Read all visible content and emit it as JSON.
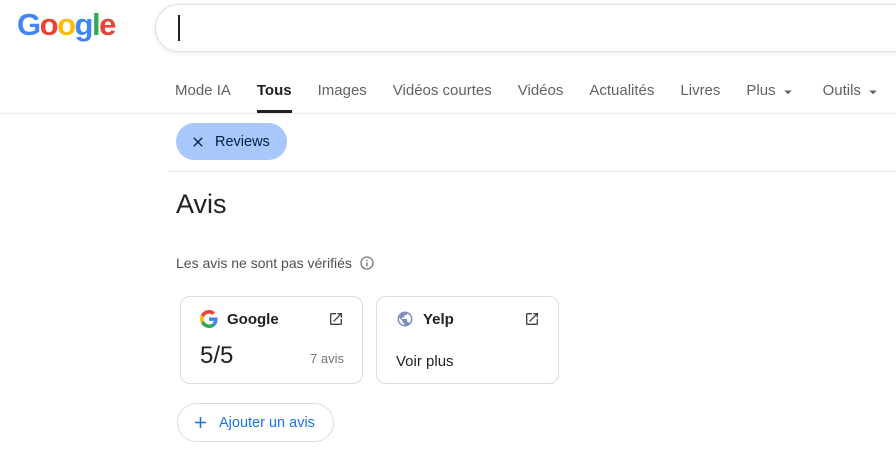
{
  "colors": {
    "accent_blue": "#1a73e8",
    "chip_background": "#a8c7fa",
    "chip_text": "#041e3f",
    "text_primary": "#202124",
    "text_secondary": "#5f6368",
    "text_muted": "#70757a",
    "card_border": "#dadce0",
    "google_brand": [
      "#4285F4",
      "#EA4335",
      "#FBBC05",
      "#4285F4",
      "#34A853",
      "#EA4335"
    ]
  },
  "header": {
    "logo_letters": [
      "G",
      "o",
      "o",
      "g",
      "l",
      "e"
    ],
    "logo_colors": [
      "#4285F4",
      "#EA4335",
      "#FBBC05",
      "#4285F4",
      "#34A853",
      "#EA4335"
    ],
    "search": {
      "value": "",
      "placeholder": ""
    }
  },
  "tabs": {
    "items": [
      {
        "label": "Mode IA",
        "active": false,
        "dropdown": false
      },
      {
        "label": "Tous",
        "active": true,
        "dropdown": false
      },
      {
        "label": "Images",
        "active": false,
        "dropdown": false
      },
      {
        "label": "Vidéos courtes",
        "active": false,
        "dropdown": false
      },
      {
        "label": "Vidéos",
        "active": false,
        "dropdown": false
      },
      {
        "label": "Actualités",
        "active": false,
        "dropdown": false
      },
      {
        "label": "Livres",
        "active": false,
        "dropdown": false
      },
      {
        "label": "Plus",
        "active": false,
        "dropdown": true
      },
      {
        "label": "Outils",
        "active": false,
        "dropdown": true
      }
    ]
  },
  "filters": {
    "chip": {
      "label": "Reviews",
      "icon": "close-icon"
    }
  },
  "content": {
    "title": "Avis",
    "disclaimer": "Les avis ne sont pas vérifiés",
    "disclaimer_icon": "info-icon",
    "cards": [
      {
        "name": "Google",
        "icon": "google-g-icon",
        "action_icon": "open-in-new-icon",
        "rating": "5/5",
        "count": "7 avis"
      },
      {
        "name": "Yelp",
        "icon": "globe-icon",
        "action_icon": "open-in-new-icon",
        "link": "Voir plus"
      }
    ],
    "add_button": {
      "label": "Ajouter un avis",
      "icon": "plus-icon"
    }
  }
}
